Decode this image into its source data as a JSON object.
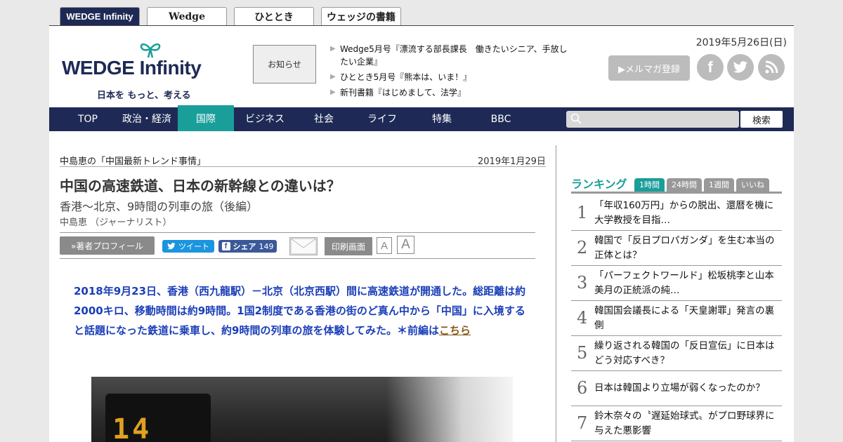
{
  "site_tabs": [
    {
      "label": "WEDGE Infinity"
    },
    {
      "label": "Wedge"
    },
    {
      "label": "ひととき"
    },
    {
      "label": "ウェッジの書籍"
    }
  ],
  "header": {
    "logo_main_left": "WEDGE",
    "logo_main_right": "Infinity",
    "logo_sub": "日本を もっと、考える",
    "notice_label": "お知らせ",
    "news": [
      "Wedge5月号『漂流する部長課長　働きたいシニア、手放したい企業』",
      "ひととき5月号『熊本は、いま！』",
      "新刊書籍『はじめまして、法学』"
    ],
    "date": "2019年5月26日(日)",
    "mail_label": "▶メルマガ登録",
    "social": {
      "fb": "f",
      "tw": "t",
      "rss": "rss"
    }
  },
  "nav": {
    "items": [
      "TOP",
      "政治・経済",
      "国際",
      "ビジネス",
      "社会",
      "ライフ",
      "特集",
      "BBC"
    ],
    "active_index": 2,
    "search_button": "検索",
    "search_placeholder": ""
  },
  "article": {
    "series": "中島恵の「中国最新トレンド事情」",
    "date": "2019年1月29日",
    "title": "中国の高速鉄道、日本の新幹線との違いは？",
    "subtitle": "香港～北京、9時間の列車の旅（後編）",
    "author": "中島恵 （ジャーナリスト）",
    "profile_button": "»著者プロフィール",
    "tweet_label": "ツイート",
    "share_label": "シェア",
    "share_count": "149",
    "print_label": "印刷画面",
    "font_small": "A",
    "font_large": "A",
    "lead": "2018年9月23日、香港（西九龍駅）－北京（北京西駅）間に高速鉄道が開通した。総距離は約2000キロ、移動時間は約9時間。1国2制度である香港の街のど真ん中から「中国」に入境すると話題になった鉄道に乗車し、約9時間の列車の旅を体験してみた。＊前編は",
    "lead_link": "こちら",
    "photo_digits": "14"
  },
  "ranking": {
    "title": "ランキング",
    "tabs": [
      "1時間",
      "24時間",
      "1週間",
      "いいね"
    ],
    "active_tab": 0,
    "items": [
      {
        "num": "1",
        "text": "「年収160万円」からの脱出、還暦を機に大学教授を目指…"
      },
      {
        "num": "2",
        "text": "韓国で「反日プロパガンダ」を生む本当の正体とは？"
      },
      {
        "num": "3",
        "text": "「パーフェクトワールド」松坂桃李と山本美月の正統派の純…"
      },
      {
        "num": "4",
        "text": "韓国国会議長による「天皇謝罪」発言の裏側"
      },
      {
        "num": "5",
        "text": "繰り返される韓国の「反日宣伝」に日本はどう対応すべき？"
      },
      {
        "num": "6",
        "text": "日本は韓国より立場が弱くなったのか？"
      },
      {
        "num": "7",
        "text": "鈴木奈々の〝遅延始球式〟がプロ野球界に与えた悪影響"
      }
    ]
  }
}
